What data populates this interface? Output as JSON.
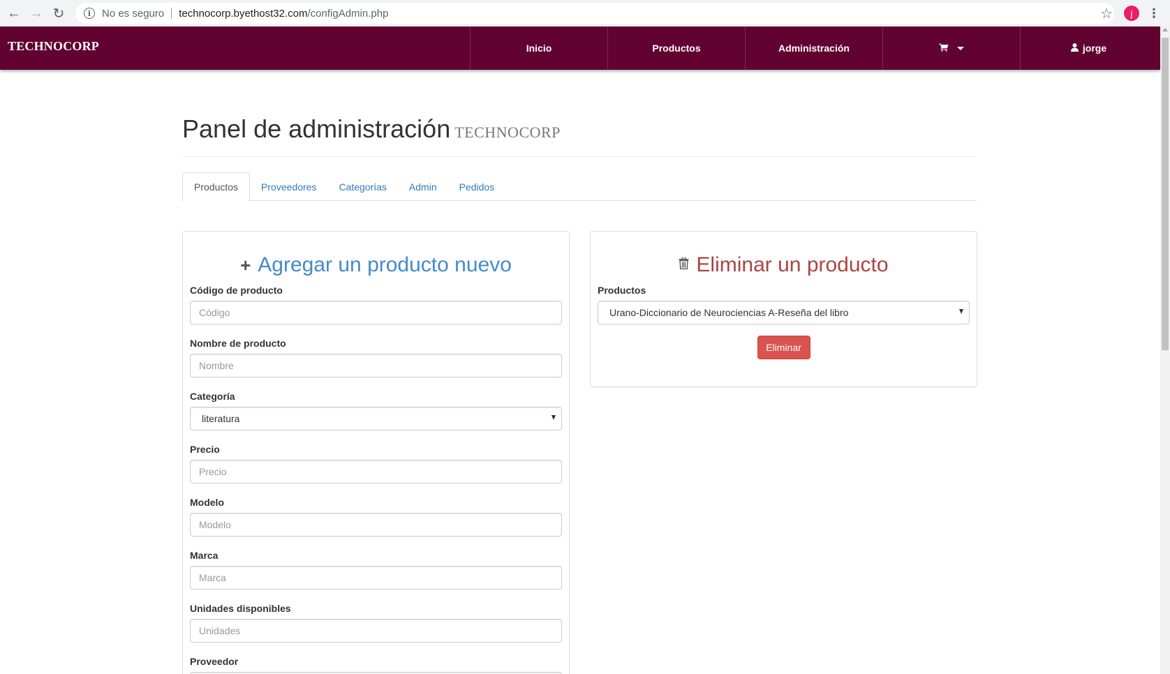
{
  "browser": {
    "security": "No es seguro",
    "url_host": "technocorp.byethost32.com",
    "url_path": "/configAdmin.php",
    "profile_initial": "j"
  },
  "navbar": {
    "brand": "TECHNOCORP",
    "items": [
      {
        "label": "Inicio"
      },
      {
        "label": "Productos"
      },
      {
        "label": "Administración"
      },
      {
        "label": ""
      },
      {
        "label": "jorge"
      }
    ]
  },
  "header": {
    "title": "Panel de administración",
    "subtitle": "TECHNOCORP"
  },
  "tabs": [
    {
      "label": "Productos",
      "active": true
    },
    {
      "label": "Proveedores"
    },
    {
      "label": "Categorías"
    },
    {
      "label": "Admin"
    },
    {
      "label": "Pedidos"
    }
  ],
  "add_panel": {
    "title": "Agregar un producto nuevo",
    "fields": [
      {
        "label": "Código de producto",
        "placeholder": "Código"
      },
      {
        "label": "Nombre de producto",
        "placeholder": "Nombre"
      },
      {
        "label": "Categoría",
        "value": "literatura"
      },
      {
        "label": "Precio",
        "placeholder": "Precio"
      },
      {
        "label": "Modelo",
        "placeholder": "Modelo"
      },
      {
        "label": "Marca",
        "placeholder": "Marca"
      },
      {
        "label": "Unidades disponibles",
        "placeholder": "Unidades"
      },
      {
        "label": "Proveedor"
      }
    ]
  },
  "delete_panel": {
    "title": "Eliminar un producto",
    "select_label": "Productos",
    "select_value": "Urano-Diccionario de Neurociencias A-Reseña del libro",
    "button": "Eliminar"
  },
  "colors": {
    "navbar": "#620230",
    "add_title": "#428bca",
    "delete_title": "#a94442",
    "danger": "#d9534f"
  }
}
